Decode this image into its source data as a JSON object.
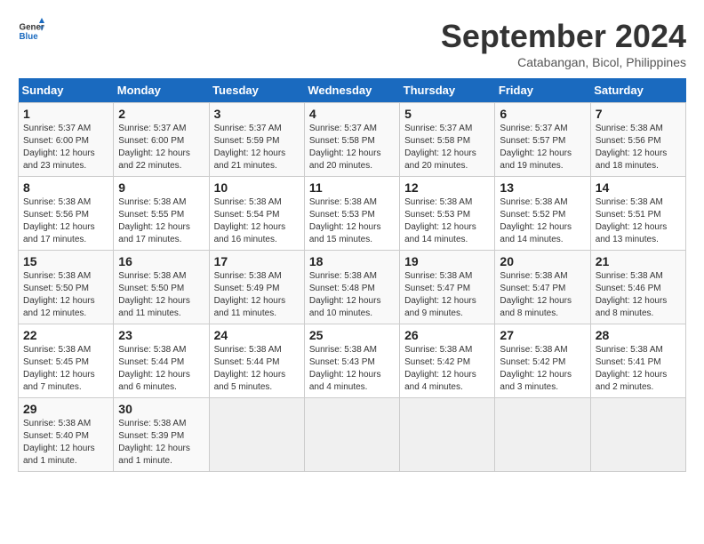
{
  "header": {
    "logo_general": "General",
    "logo_blue": "Blue",
    "month_year": "September 2024",
    "location": "Catabangan, Bicol, Philippines"
  },
  "calendar": {
    "weekdays": [
      "Sunday",
      "Monday",
      "Tuesday",
      "Wednesday",
      "Thursday",
      "Friday",
      "Saturday"
    ],
    "weeks": [
      [
        {
          "day": "",
          "info": ""
        },
        {
          "day": "2",
          "info": "Sunrise: 5:37 AM\nSunset: 6:00 PM\nDaylight: 12 hours\nand 22 minutes."
        },
        {
          "day": "3",
          "info": "Sunrise: 5:37 AM\nSunset: 5:59 PM\nDaylight: 12 hours\nand 21 minutes."
        },
        {
          "day": "4",
          "info": "Sunrise: 5:37 AM\nSunset: 5:58 PM\nDaylight: 12 hours\nand 20 minutes."
        },
        {
          "day": "5",
          "info": "Sunrise: 5:37 AM\nSunset: 5:58 PM\nDaylight: 12 hours\nand 20 minutes."
        },
        {
          "day": "6",
          "info": "Sunrise: 5:37 AM\nSunset: 5:57 PM\nDaylight: 12 hours\nand 19 minutes."
        },
        {
          "day": "7",
          "info": "Sunrise: 5:38 AM\nSunset: 5:56 PM\nDaylight: 12 hours\nand 18 minutes."
        }
      ],
      [
        {
          "day": "1",
          "info": "Sunrise: 5:37 AM\nSunset: 6:00 PM\nDaylight: 12 hours\nand 23 minutes."
        },
        {
          "day": "9",
          "info": "Sunrise: 5:38 AM\nSunset: 5:55 PM\nDaylight: 12 hours\nand 17 minutes."
        },
        {
          "day": "10",
          "info": "Sunrise: 5:38 AM\nSunset: 5:54 PM\nDaylight: 12 hours\nand 16 minutes."
        },
        {
          "day": "11",
          "info": "Sunrise: 5:38 AM\nSunset: 5:53 PM\nDaylight: 12 hours\nand 15 minutes."
        },
        {
          "day": "12",
          "info": "Sunrise: 5:38 AM\nSunset: 5:53 PM\nDaylight: 12 hours\nand 14 minutes."
        },
        {
          "day": "13",
          "info": "Sunrise: 5:38 AM\nSunset: 5:52 PM\nDaylight: 12 hours\nand 14 minutes."
        },
        {
          "day": "14",
          "info": "Sunrise: 5:38 AM\nSunset: 5:51 PM\nDaylight: 12 hours\nand 13 minutes."
        }
      ],
      [
        {
          "day": "8",
          "info": "Sunrise: 5:38 AM\nSunset: 5:56 PM\nDaylight: 12 hours\nand 17 minutes."
        },
        {
          "day": "16",
          "info": "Sunrise: 5:38 AM\nSunset: 5:50 PM\nDaylight: 12 hours\nand 11 minutes."
        },
        {
          "day": "17",
          "info": "Sunrise: 5:38 AM\nSunset: 5:49 PM\nDaylight: 12 hours\nand 11 minutes."
        },
        {
          "day": "18",
          "info": "Sunrise: 5:38 AM\nSunset: 5:48 PM\nDaylight: 12 hours\nand 10 minutes."
        },
        {
          "day": "19",
          "info": "Sunrise: 5:38 AM\nSunset: 5:47 PM\nDaylight: 12 hours\nand 9 minutes."
        },
        {
          "day": "20",
          "info": "Sunrise: 5:38 AM\nSunset: 5:47 PM\nDaylight: 12 hours\nand 8 minutes."
        },
        {
          "day": "21",
          "info": "Sunrise: 5:38 AM\nSunset: 5:46 PM\nDaylight: 12 hours\nand 8 minutes."
        }
      ],
      [
        {
          "day": "15",
          "info": "Sunrise: 5:38 AM\nSunset: 5:50 PM\nDaylight: 12 hours\nand 12 minutes."
        },
        {
          "day": "23",
          "info": "Sunrise: 5:38 AM\nSunset: 5:44 PM\nDaylight: 12 hours\nand 6 minutes."
        },
        {
          "day": "24",
          "info": "Sunrise: 5:38 AM\nSunset: 5:44 PM\nDaylight: 12 hours\nand 5 minutes."
        },
        {
          "day": "25",
          "info": "Sunrise: 5:38 AM\nSunset: 5:43 PM\nDaylight: 12 hours\nand 4 minutes."
        },
        {
          "day": "26",
          "info": "Sunrise: 5:38 AM\nSunset: 5:42 PM\nDaylight: 12 hours\nand 4 minutes."
        },
        {
          "day": "27",
          "info": "Sunrise: 5:38 AM\nSunset: 5:42 PM\nDaylight: 12 hours\nand 3 minutes."
        },
        {
          "day": "28",
          "info": "Sunrise: 5:38 AM\nSunset: 5:41 PM\nDaylight: 12 hours\nand 2 minutes."
        }
      ],
      [
        {
          "day": "22",
          "info": "Sunrise: 5:38 AM\nSunset: 5:45 PM\nDaylight: 12 hours\nand 7 minutes."
        },
        {
          "day": "30",
          "info": "Sunrise: 5:38 AM\nSunset: 5:39 PM\nDaylight: 12 hours\nand 1 minute."
        },
        {
          "day": "",
          "info": ""
        },
        {
          "day": "",
          "info": ""
        },
        {
          "day": "",
          "info": ""
        },
        {
          "day": "",
          "info": ""
        },
        {
          "day": "",
          "info": ""
        }
      ],
      [
        {
          "day": "29",
          "info": "Sunrise: 5:38 AM\nSunset: 5:40 PM\nDaylight: 12 hours\nand 1 minute."
        },
        {
          "day": "",
          "info": ""
        },
        {
          "day": "",
          "info": ""
        },
        {
          "day": "",
          "info": ""
        },
        {
          "day": "",
          "info": ""
        },
        {
          "day": "",
          "info": ""
        },
        {
          "day": "",
          "info": ""
        }
      ]
    ]
  }
}
